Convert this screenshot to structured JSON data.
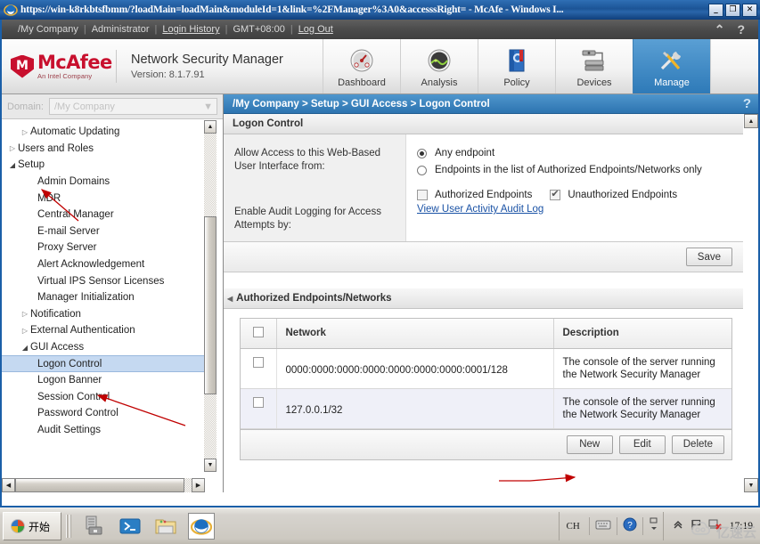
{
  "window": {
    "title": "https://win-k8rkbtsfbmm/?loadMain=loadMain&moduleId=1&link=%2FManager%3A0&accesssRight= - McAfe - Windows I...",
    "minimize_label": "_",
    "maximize_label": "❐",
    "close_label": "✕",
    "ie_icon": "internet-explorer-icon"
  },
  "userbar": {
    "company": "/My Company",
    "user": "Administrator",
    "login_history": "Login History",
    "timezone": "GMT+08:00",
    "logout": "Log Out",
    "collapse_icon": "chevron-up-icon",
    "help_icon": "question-mark-icon",
    "sep": "|"
  },
  "brand": {
    "logo_name": "McAfee",
    "logo_tagline": "An Intel Company",
    "product": "Network Security Manager",
    "version": "Version: 8.1.7.91"
  },
  "nav": {
    "tabs": [
      {
        "label": "Dashboard",
        "icon": "gauge-icon",
        "active": false
      },
      {
        "label": "Analysis",
        "icon": "radar-icon",
        "active": false
      },
      {
        "label": "Policy",
        "icon": "policy-book-icon",
        "active": false
      },
      {
        "label": "Devices",
        "icon": "server-stack-icon",
        "active": false
      },
      {
        "label": "Manage",
        "icon": "tools-icon",
        "active": true
      }
    ]
  },
  "sidebar": {
    "domain_label": "Domain:",
    "domain_value": "/My Company",
    "domain_arrow_icon": "chevron-down-icon",
    "tree": [
      {
        "label": "Automatic Updating",
        "level": 2,
        "twisty": "collapsed"
      },
      {
        "label": "Users and Roles",
        "level": 1,
        "twisty": "collapsed"
      },
      {
        "label": "Setup",
        "level": 1,
        "twisty": "expanded"
      },
      {
        "label": "Admin Domains",
        "level": 2,
        "twisty": "none"
      },
      {
        "label": "MDR",
        "level": 2,
        "twisty": "none"
      },
      {
        "label": "Central Manager",
        "level": 2,
        "twisty": "none"
      },
      {
        "label": "E-mail Server",
        "level": 2,
        "twisty": "none"
      },
      {
        "label": "Proxy Server",
        "level": 2,
        "twisty": "none"
      },
      {
        "label": "Alert Acknowledgement",
        "level": 2,
        "twisty": "none"
      },
      {
        "label": "Virtual IPS Sensor Licenses",
        "level": 2,
        "twisty": "none"
      },
      {
        "label": "Manager Initialization",
        "level": 2,
        "twisty": "none"
      },
      {
        "label": "Notification",
        "level": 2,
        "twisty": "collapsed"
      },
      {
        "label": "External Authentication",
        "level": 2,
        "twisty": "collapsed"
      },
      {
        "label": "GUI Access",
        "level": 2,
        "twisty": "expanded"
      },
      {
        "label": "Logon Control",
        "level": 3,
        "twisty": "none",
        "selected": true
      },
      {
        "label": "Logon Banner",
        "level": 3,
        "twisty": "none"
      },
      {
        "label": "Session Control",
        "level": 3,
        "twisty": "none"
      },
      {
        "label": "Password Control",
        "level": 3,
        "twisty": "none"
      },
      {
        "label": "Audit Settings",
        "level": 3,
        "twisty": "none"
      }
    ],
    "scroll_up_icon": "triangle-up-icon",
    "scroll_down_icon": "triangle-down-icon",
    "scroll_left_icon": "triangle-left-icon",
    "scroll_right_icon": "triangle-right-icon"
  },
  "main": {
    "breadcrumb": "/My Company > Setup > GUI Access > Logon Control",
    "help_icon": "question-mark-icon",
    "panel_title": "Logon Control",
    "form": {
      "label_access": "Allow Access to this Web-Based User Interface from:",
      "options": [
        {
          "label": "Any endpoint",
          "selected": true
        },
        {
          "label": "Endpoints in the list of Authorized Endpoints/Networks only",
          "selected": false
        }
      ],
      "label_audit": "Enable Audit Logging for Access Attempts by:",
      "checkboxes": [
        {
          "label": "Authorized Endpoints",
          "checked": false
        },
        {
          "label": "Unauthorized Endpoints",
          "checked": true
        }
      ],
      "audit_link": "View User Activity Audit Log",
      "save_label": "Save"
    },
    "endpoints_section": {
      "title": "Authorized Endpoints/Networks",
      "collapse_icon": "triangle-left-icon",
      "columns": [
        "",
        "Network",
        "Description"
      ],
      "rows": [
        {
          "checked": false,
          "network": "0000:0000:0000:0000:0000:0000:0000:0001/128",
          "description": "The console of the server running the Network Security Manager"
        },
        {
          "checked": false,
          "network": "127.0.0.1/32",
          "description": "The console of the server running the Network Security Manager"
        }
      ],
      "actions": [
        {
          "label": "New"
        },
        {
          "label": "Edit"
        },
        {
          "label": "Delete"
        }
      ]
    },
    "scroll_up_icon": "triangle-up-icon",
    "scroll_down_icon": "triangle-down-icon"
  },
  "taskbar": {
    "start_label": "开始",
    "start_icon": "windows-orb-icon",
    "quick_launch": [
      {
        "icon": "server-manager-icon",
        "selected": false
      },
      {
        "icon": "powershell-icon",
        "selected": false
      },
      {
        "icon": "file-explorer-icon",
        "selected": false
      },
      {
        "icon": "internet-explorer-icon",
        "selected": true
      }
    ],
    "tray": {
      "ime_label": "CH",
      "keyboard_icon": "keyboard-icon",
      "help_icon": "question-circle-icon",
      "expand_icon": "show-hidden-icons-icon",
      "chevron_icon": "chevron-up-icon",
      "flag_icon": "action-center-flag-icon",
      "network_icon": "network-error-icon",
      "clock": "17:19"
    }
  },
  "watermark": {
    "text": "亿速云",
    "icon": "cloud-icon"
  },
  "colors": {
    "accent_blue": "#2d74b0",
    "brand_red": "#c8102e",
    "selection_blue": "#c5d9f1",
    "annotation_red": "#c00000"
  }
}
